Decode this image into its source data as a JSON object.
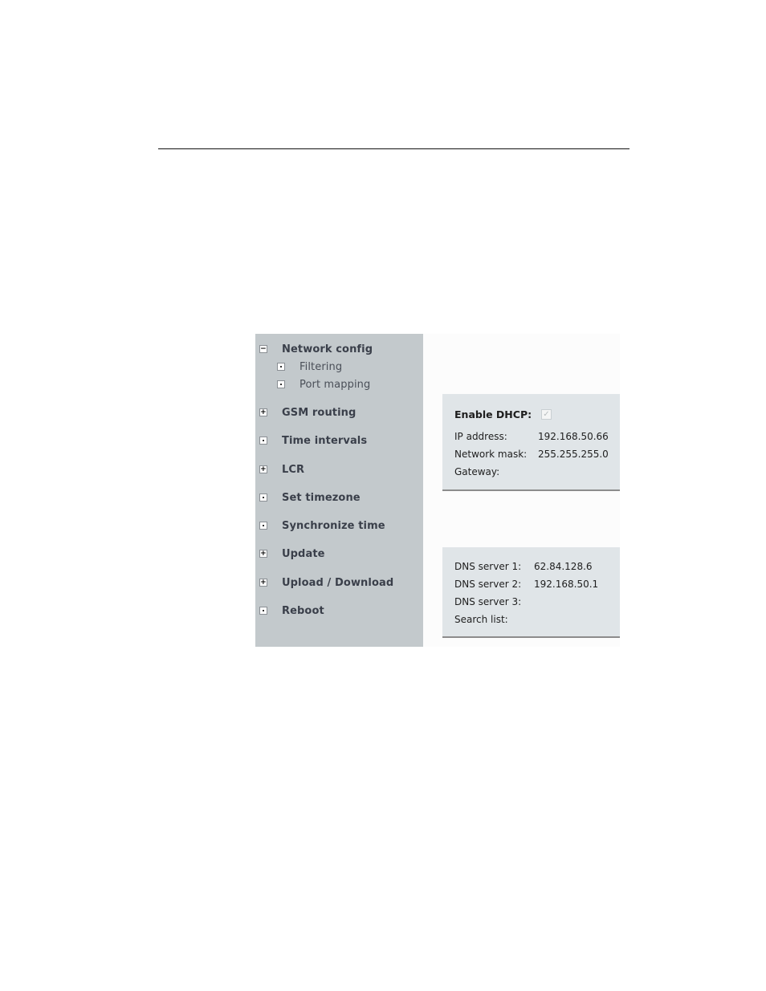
{
  "sidebar": {
    "items": [
      {
        "label": "Network config",
        "icon": "minus-box-icon",
        "expanded": true,
        "level": 0
      },
      {
        "label": "Filtering",
        "icon": "dot-box-icon",
        "level": 1
      },
      {
        "label": "Port mapping",
        "icon": "dot-box-icon",
        "level": 1
      },
      {
        "label": "GSM routing",
        "icon": "plus-box-icon",
        "level": 0
      },
      {
        "label": "Time intervals",
        "icon": "dot-box-icon",
        "level": 0
      },
      {
        "label": "LCR",
        "icon": "plus-box-icon",
        "level": 0
      },
      {
        "label": "Set timezone",
        "icon": "dot-box-icon",
        "level": 0
      },
      {
        "label": "Synchronize time",
        "icon": "dot-box-icon",
        "level": 0
      },
      {
        "label": "Update",
        "icon": "plus-box-icon",
        "level": 0
      },
      {
        "label": "Upload / Download",
        "icon": "plus-box-icon",
        "level": 0
      },
      {
        "label": "Reboot",
        "icon": "dot-box-icon",
        "level": 0
      }
    ]
  },
  "network_panel": {
    "dhcp_label": "Enable DHCP:",
    "dhcp_checked": true,
    "dhcp_check_glyph": "✓",
    "ip_label": "IP address:",
    "ip_value": "192.168.50.66",
    "mask_label": "Network mask:",
    "mask_value": "255.255.255.0",
    "gateway_label": "Gateway:",
    "gateway_value": ""
  },
  "dns_panel": {
    "dns1_label": "DNS server 1:",
    "dns1_value": "62.84.128.6",
    "dns2_label": "DNS server 2:",
    "dns2_value": "192.168.50.1",
    "dns3_label": "DNS server 3:",
    "dns3_value": "",
    "search_label": "Search list:",
    "search_value": ""
  },
  "icons": {
    "minus": "−",
    "plus": "+"
  }
}
